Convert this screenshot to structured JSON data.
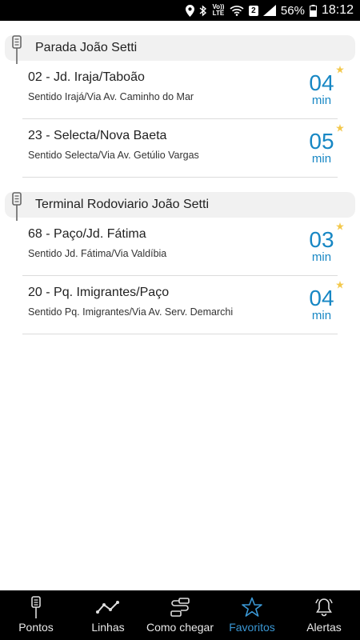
{
  "status_bar": {
    "volte": "Vo)) LTE",
    "sim": "2",
    "battery_pct": "56%",
    "time": "18:12"
  },
  "stops": [
    {
      "title": "Parada João Setti",
      "routes": [
        {
          "name": "02 - Jd. Iraja/Taboão",
          "direction": "Sentido Irajá/Via Av. Caminho do Mar",
          "eta": "04",
          "unit": "min"
        },
        {
          "name": "23 - Selecta/Nova Baeta",
          "direction": "Sentido Selecta/Via Av. Getúlio Vargas",
          "eta": "05",
          "unit": "min"
        }
      ]
    },
    {
      "title": "Terminal Rodoviario João Setti",
      "routes": [
        {
          "name": "68 - Paço/Jd. Fátima",
          "direction": "Sentido Jd. Fátima/Via Valdíbia",
          "eta": "03",
          "unit": "min"
        },
        {
          "name": "20 - Pq. Imigrantes/Paço",
          "direction": "Sentido Pq. Imigrantes/Via Av. Serv. Demarchi",
          "eta": "04",
          "unit": "min"
        }
      ]
    }
  ],
  "nav": {
    "items": [
      {
        "label": "Pontos",
        "icon": "bus-stop-icon"
      },
      {
        "label": "Linhas",
        "icon": "route-line-icon"
      },
      {
        "label": "Como chegar",
        "icon": "directions-icon"
      },
      {
        "label": "Favoritos",
        "icon": "star-icon",
        "active": true
      },
      {
        "label": "Alertas",
        "icon": "bell-icon"
      }
    ]
  },
  "colors": {
    "accent": "#1787c4",
    "star": "#f3c84b",
    "header_bg": "#f1f1f1",
    "nav_bg": "#000000",
    "nav_active": "#3a97d4"
  }
}
